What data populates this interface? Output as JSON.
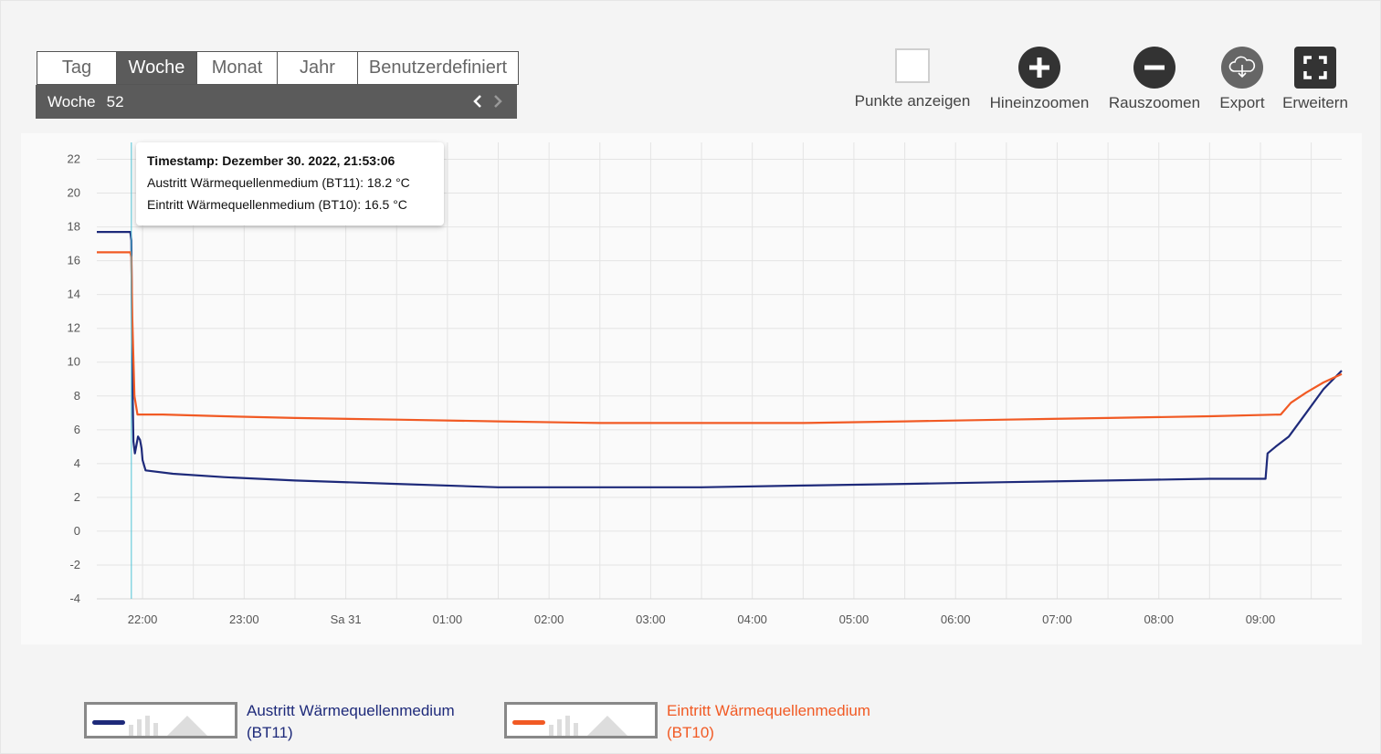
{
  "tabs": [
    {
      "label": "Tag",
      "active": false
    },
    {
      "label": "Woche",
      "active": true
    },
    {
      "label": "Monat",
      "active": false
    },
    {
      "label": "Jahr",
      "active": false
    },
    {
      "label": "Benutzerdefiniert",
      "active": false
    }
  ],
  "period": {
    "label": "Woche",
    "number": "52"
  },
  "toolbar": {
    "show_points": "Punkte anzeigen",
    "zoom_in": "Hineinzoomen",
    "zoom_out": "Rauszoomen",
    "export": "Export",
    "expand": "Erweitern"
  },
  "tooltip": {
    "timestamp": "Timestamp: Dezember 30. 2022, 21:53:06",
    "line1": "Austritt Wärmequellenmedium (BT11): 18.2 °C",
    "line2": "Eintritt Wärmequellenmedium (BT10): 16.5 °C"
  },
  "colors": {
    "bt11": "#1e2a7a",
    "bt10": "#f15a24",
    "cursor": "#4fc3d6",
    "grid": "#e4e4e4"
  },
  "legend": [
    {
      "line1": "Austritt Wärmequellenmedium",
      "line2": "(BT11)"
    },
    {
      "line1": "Eintritt Wärmequellenmedium",
      "line2": "(BT10)"
    }
  ],
  "chart_data": {
    "type": "line",
    "y_ticks": [
      "22",
      "20",
      "18",
      "16",
      "14",
      "12",
      "10",
      "8",
      "6",
      "4",
      "2",
      "0",
      "-2",
      "-4"
    ],
    "ylim": [
      -4,
      23
    ],
    "x_ticks": [
      "22:00",
      "23:00",
      "Sa 31",
      "01:00",
      "02:00",
      "03:00",
      "04:00",
      "05:00",
      "06:00",
      "07:00",
      "08:00",
      "09:00"
    ],
    "x_tick_hours": [
      22,
      23,
      24,
      25,
      26,
      27,
      28,
      29,
      30,
      31,
      32,
      33
    ],
    "xlim": [
      21.55,
      33.8
    ],
    "cursor_x": 21.89,
    "series": [
      {
        "name": "Austritt Wärmequellenmedium (BT11)",
        "points": [
          [
            21.55,
            17.7
          ],
          [
            21.88,
            17.7
          ],
          [
            21.89,
            17.2
          ],
          [
            21.9,
            9.0
          ],
          [
            21.91,
            5.3
          ],
          [
            21.925,
            4.6
          ],
          [
            21.94,
            5.1
          ],
          [
            21.955,
            5.6
          ],
          [
            21.975,
            5.4
          ],
          [
            21.99,
            4.9
          ],
          [
            22.0,
            4.2
          ],
          [
            22.03,
            3.6
          ],
          [
            22.3,
            3.4
          ],
          [
            22.8,
            3.2
          ],
          [
            23.5,
            3.0
          ],
          [
            24.5,
            2.8
          ],
          [
            25.5,
            2.6
          ],
          [
            26.5,
            2.6
          ],
          [
            27.5,
            2.6
          ],
          [
            28.5,
            2.7
          ],
          [
            29.5,
            2.8
          ],
          [
            30.5,
            2.9
          ],
          [
            31.5,
            3.0
          ],
          [
            32.5,
            3.1
          ],
          [
            33.05,
            3.1
          ],
          [
            33.07,
            4.6
          ],
          [
            33.15,
            5.0
          ],
          [
            33.28,
            5.6
          ],
          [
            33.45,
            7.0
          ],
          [
            33.62,
            8.4
          ],
          [
            33.8,
            9.5
          ]
        ]
      },
      {
        "name": "Eintritt Wärmequellenmedium (BT10)",
        "points": [
          [
            21.55,
            16.5
          ],
          [
            21.88,
            16.5
          ],
          [
            21.89,
            16.2
          ],
          [
            21.9,
            12.5
          ],
          [
            21.92,
            8.0
          ],
          [
            21.95,
            6.9
          ],
          [
            22.2,
            6.9
          ],
          [
            22.8,
            6.8
          ],
          [
            23.5,
            6.7
          ],
          [
            24.5,
            6.6
          ],
          [
            25.5,
            6.5
          ],
          [
            26.5,
            6.4
          ],
          [
            27.5,
            6.4
          ],
          [
            28.5,
            6.4
          ],
          [
            29.5,
            6.5
          ],
          [
            30.5,
            6.6
          ],
          [
            31.5,
            6.7
          ],
          [
            32.5,
            6.8
          ],
          [
            33.2,
            6.9
          ],
          [
            33.3,
            7.6
          ],
          [
            33.45,
            8.2
          ],
          [
            33.62,
            8.8
          ],
          [
            33.8,
            9.3
          ]
        ]
      }
    ]
  }
}
